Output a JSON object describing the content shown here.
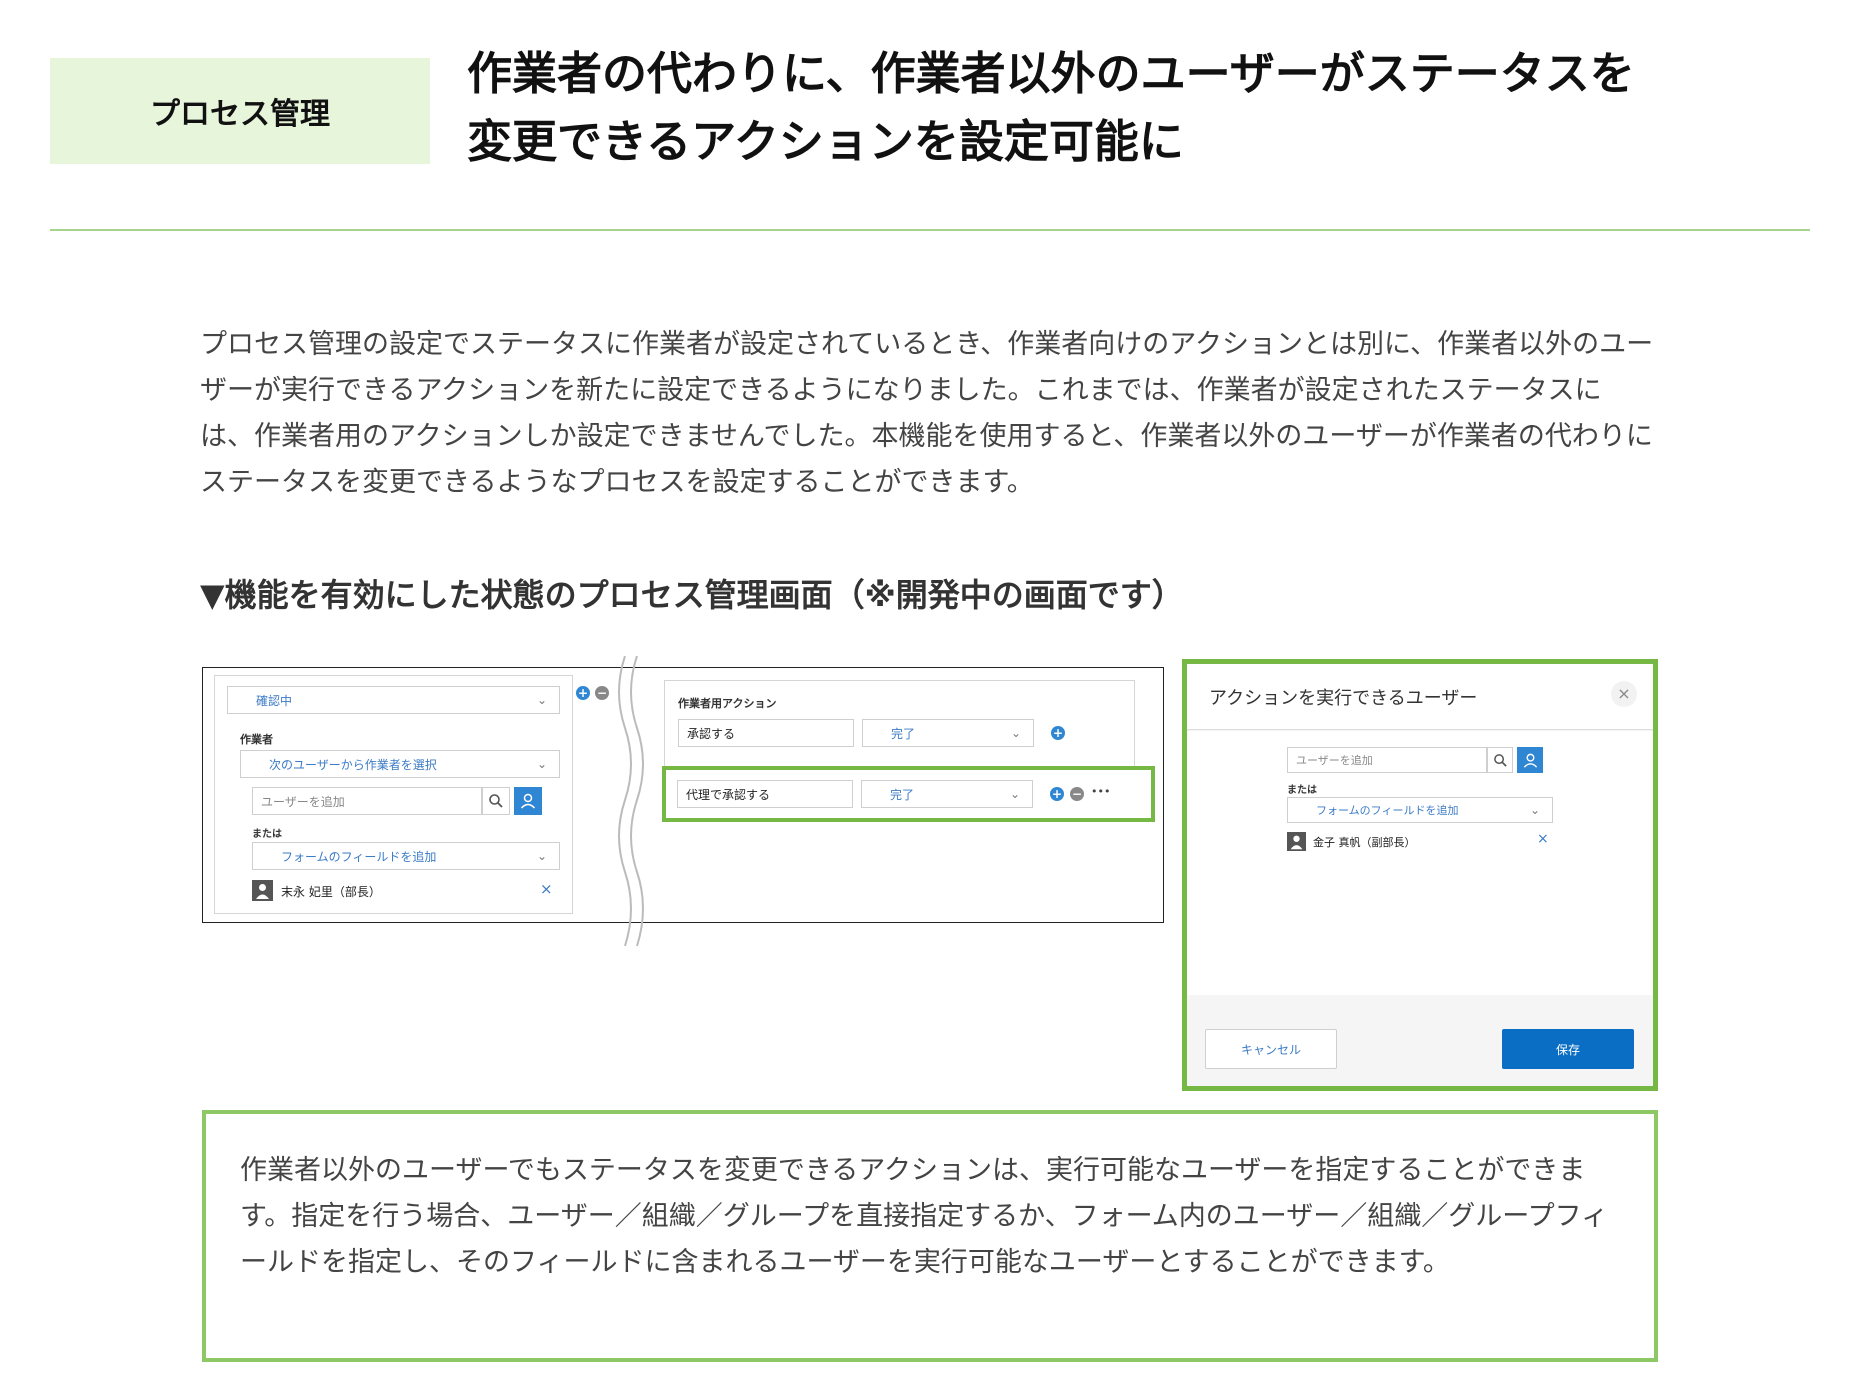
{
  "header": {
    "category": "プロセス管理",
    "title_line1": "作業者の代わりに、作業者以外のユーザーがステータスを",
    "title_line2": "変更できるアクションを設定可能に"
  },
  "description": "プロセス管理の設定でステータスに作業者が設定されているとき、作業者向けのアクションとは別に、作業者以外のユーザーが実行できるアクションを新たに設定できるようになりました。これまでは、作業者が設定されたステータスには、作業者用のアクションしか設定できませんでした。本機能を使用すると、作業者以外のユーザーが作業者の代わりにステータスを変更できるようなプロセスを設定することができます。",
  "subheading": "▼機能を有効にした状態のプロセス管理画面（※開発中の画面です）",
  "screenshot": {
    "status_select": "確認中",
    "worker_label": "作業者",
    "worker_mode_select": "次のユーザーから作業者を選択",
    "add_user_placeholder": "ユーザーを追加",
    "or_label": "または",
    "form_field_select": "フォームのフィールドを追加",
    "assigned_user": "末永 妃里（部長）",
    "remove_glyph": "×",
    "actions_label": "作業者用アクション",
    "action1_name": "承認する",
    "action1_next": "完了",
    "action2_name": "代理で承認する",
    "action2_next": "完了",
    "more_glyph": "•••"
  },
  "dialog": {
    "title": "アクションを実行できるユーザー",
    "close_glyph": "×",
    "add_user_placeholder": "ユーザーを追加",
    "or_label": "または",
    "form_field_select": "フォームのフィールドを追加",
    "assigned_user": "金子 真帆（副部長）",
    "remove_glyph": "×",
    "cancel_label": "キャンセル",
    "save_label": "保存"
  },
  "note": "作業者以外のユーザーでもステータスを変更できるアクションは、実行可能なユーザーを指定することができます。指定を行う場合、ユーザー／組織／グループを直接指定するか、フォーム内のユーザー／組織／グループフィールドを指定し、そのフィールドに含まれるユーザーを実行可能なユーザーとすることができます。",
  "colors": {
    "accent_green": "#75b843",
    "category_bg": "#e7f5da",
    "link_blue": "#3b7bc7",
    "primary_button": "#0b6ec5"
  }
}
